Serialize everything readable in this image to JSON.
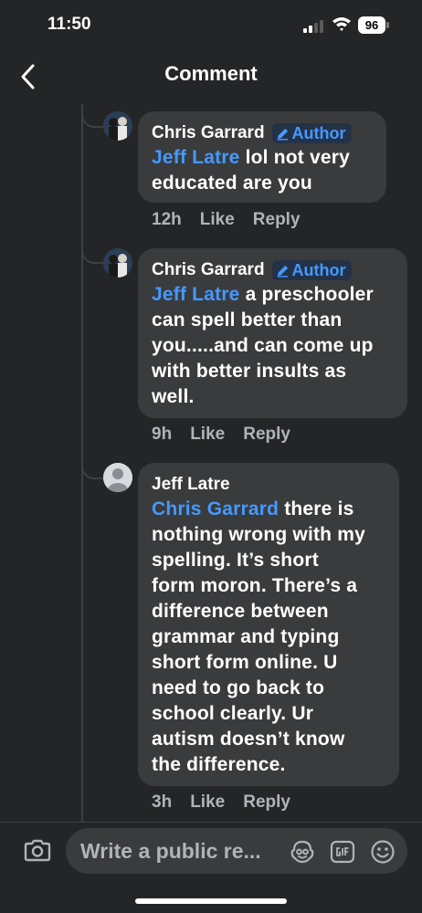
{
  "status_bar": {
    "time": "11:50",
    "battery": "96"
  },
  "header": {
    "title": "Comment"
  },
  "comments": [
    {
      "author": "Chris Garrard",
      "badge": "Author",
      "mention": "Jeff Latre",
      "text": " lol not very\neducated are you",
      "time": "12h",
      "like": "Like",
      "reply": "Reply"
    },
    {
      "author": "Chris Garrard",
      "badge": "Author",
      "mention": "Jeff Latre",
      "text": " a preschooler\ncan spell better than\nyou.....and can come up\nwith better insults as\nwell.",
      "time": "9h",
      "like": "Like",
      "reply": "Reply"
    },
    {
      "author": "Jeff Latre",
      "mention": "Chris Garrard",
      "text": " there is\nnothing wrong with my\nspelling.   It’s short\nform moron.   There’s a\ndifference between\ngrammar and typing\nshort form online.    U\nneed to go back to\nschool clearly.   Ur\nautism doesn’t know\nthe difference.",
      "time": "3h",
      "like": "Like",
      "reply": "Reply"
    }
  ],
  "composer": {
    "placeholder": "Write a public re...",
    "icons": [
      "camera-icon",
      "avatar-sticker-icon",
      "gif-icon",
      "emoji-icon"
    ]
  },
  "colors": {
    "background": "#242526",
    "bubble": "#3a3b3c",
    "link": "#4599ff",
    "meta": "#b0b3b8"
  }
}
